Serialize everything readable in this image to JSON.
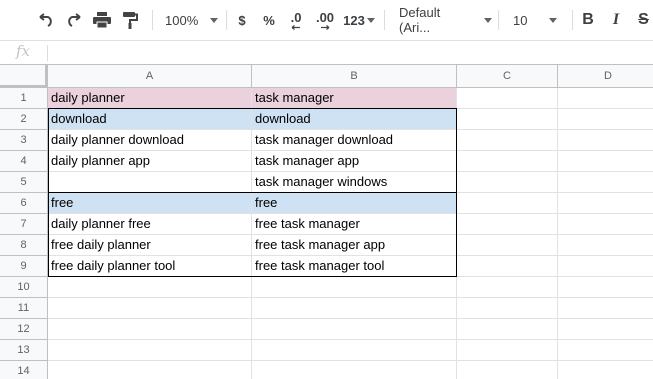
{
  "toolbar": {
    "zoom": "100%",
    "currency": "$",
    "percent": "%",
    "decrease_decimals": ".0",
    "increase_decimals": ".00",
    "number_format": "123",
    "font_family": "Default (Ari...",
    "font_size": "10",
    "bold": "B",
    "italic": "I",
    "strikethrough": "S"
  },
  "formula_bar": {
    "fx_label": "fx",
    "value": ""
  },
  "columns": [
    "A",
    "B",
    "C",
    "D"
  ],
  "rows": [
    "1",
    "2",
    "3",
    "4",
    "5",
    "6",
    "7",
    "8",
    "9",
    "10",
    "11",
    "12",
    "13",
    "14"
  ],
  "cells": {
    "r1": {
      "a": "daily planner",
      "b": "task manager"
    },
    "r2": {
      "a": "download",
      "b": "download"
    },
    "r3": {
      "a": "daily planner download",
      "b": "task manager download"
    },
    "r4": {
      "a": "daily planner app",
      "b": "task manager app"
    },
    "r5": {
      "a": "",
      "b": "task manager windows"
    },
    "r6": {
      "a": "free",
      "b": "free"
    },
    "r7": {
      "a": "daily planner free",
      "b": "free task manager"
    },
    "r8": {
      "a": "free daily planner",
      "b": "free task manager app"
    },
    "r9": {
      "a": "free daily planner tool",
      "b": "free task manager tool"
    }
  },
  "colors": {
    "header_row_fill": "#ead1dc",
    "section_row_fill": "#cfe2f3",
    "border": "#000000"
  }
}
